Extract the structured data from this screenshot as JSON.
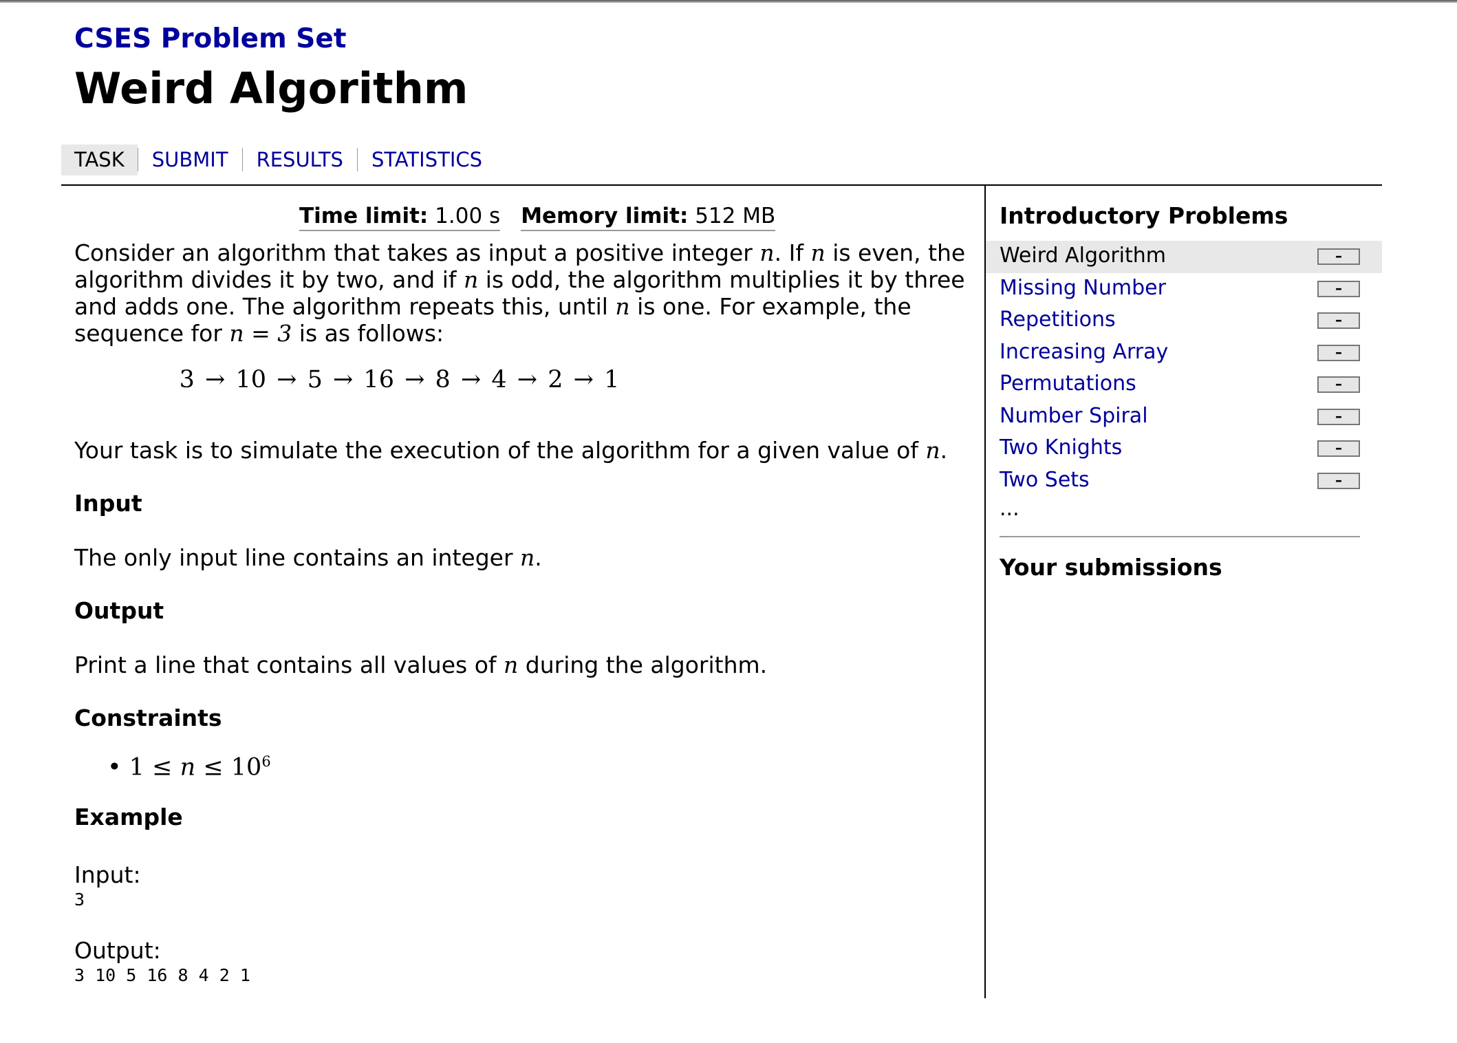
{
  "site": {
    "title": "CSES Problem Set"
  },
  "task": {
    "title": "Weird Algorithm"
  },
  "tabs": [
    {
      "label": "TASK",
      "active": true
    },
    {
      "label": "SUBMIT"
    },
    {
      "label": "RESULTS"
    },
    {
      "label": "STATISTICS"
    }
  ],
  "limits": {
    "time_label": "Time limit:",
    "time_value": "1.00 s",
    "memory_label": "Memory limit:",
    "memory_value": "512 MB"
  },
  "statement": {
    "p1": {
      "t1": "Consider an algorithm that takes as input a positive integer ",
      "t2": ". If ",
      "t3": " is even, the algorithm divides it by two, and if ",
      "t4": " is odd, the algorithm multiplies it by three and adds one. The algorithm repeats this, until ",
      "t5": " is one. For example, the sequence for ",
      "t6": " is as follows:",
      "var": "n",
      "eq": "n = 3"
    },
    "sequence": "3 → 10 → 5 → 16 → 8 → 4 → 2 → 1",
    "p2": {
      "t1": "Your task is to simulate the execution of the algorithm for a given value of ",
      "var": "n",
      "t2": "."
    }
  },
  "input": {
    "heading": "Input",
    "t1": "The only input line contains an integer ",
    "var": "n",
    "t2": "."
  },
  "output": {
    "heading": "Output",
    "t1": "Print a line that contains all values of ",
    "var": "n",
    "t2": " during the algorithm."
  },
  "constraints": {
    "heading": "Constraints",
    "lhs": "1 ≤ ",
    "var": "n",
    "mid": " ≤ 10",
    "exp": "6"
  },
  "example": {
    "heading": "Example",
    "input_label": "Input:",
    "input_value": "3",
    "output_label": "Output:",
    "output_value": "3 10 5 16 8 4 2 1"
  },
  "sidebar": {
    "heading": "Introductory Problems",
    "problems": [
      {
        "name": "Weird Algorithm",
        "status": "–",
        "current": true
      },
      {
        "name": "Missing Number",
        "status": "–"
      },
      {
        "name": "Repetitions",
        "status": "–"
      },
      {
        "name": "Increasing Array",
        "status": "–"
      },
      {
        "name": "Permutations",
        "status": "–"
      },
      {
        "name": "Number Spiral",
        "status": "–"
      },
      {
        "name": "Two Knights",
        "status": "–"
      },
      {
        "name": "Two Sets",
        "status": "–"
      }
    ],
    "more": "...",
    "submissions_heading": "Your submissions"
  },
  "colors": {
    "link": "#00009c",
    "active_bg": "#e8e8e8"
  }
}
